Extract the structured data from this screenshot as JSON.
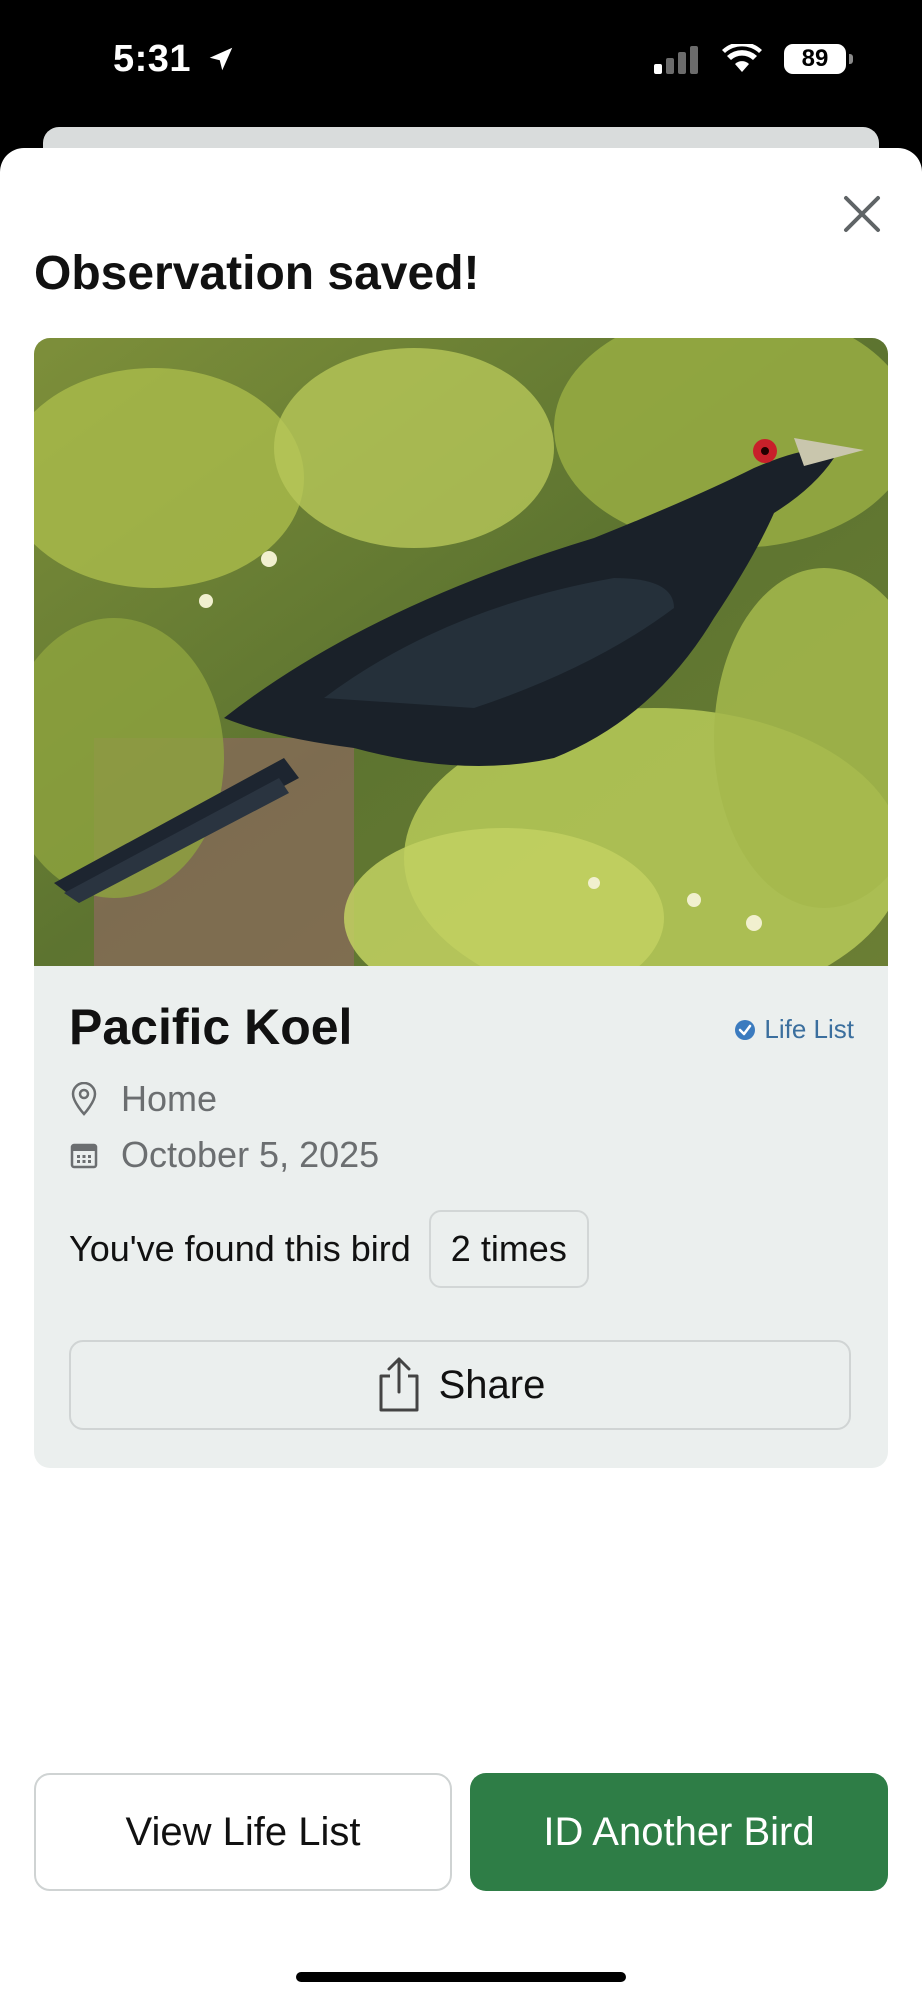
{
  "status_bar": {
    "time": "5:31",
    "battery": "89"
  },
  "modal": {
    "title": "Observation saved!",
    "close_icon": "close-icon"
  },
  "observation": {
    "species": "Pacific Koel",
    "badge": "Life List",
    "location": "Home",
    "date": "October 5, 2025",
    "found_text": "You've found this bird",
    "found_count": "2 times",
    "share_label": "Share"
  },
  "actions": {
    "view_life_list": "View Life List",
    "id_another": "ID Another Bird"
  },
  "colors": {
    "primary_green": "#2e7d46",
    "card_background": "#ebefee",
    "badge_blue": "#3b6f9e"
  }
}
